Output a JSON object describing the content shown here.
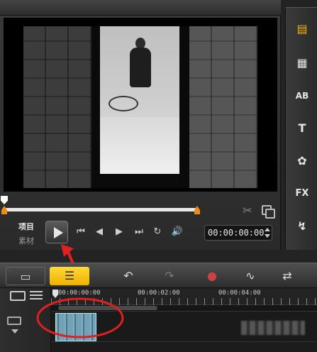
{
  "preview": {
    "mode_project": "项目",
    "mode_clip": "素材",
    "timecode": "00:00:00:00",
    "progress": 0
  },
  "transport": {
    "prev_icon": "⏮",
    "step_back_icon": "◀",
    "step_fwd_icon": "▶",
    "next_icon": "⏭",
    "repeat_icon": "↻",
    "volume_icon": "🔊"
  },
  "library_tools": [
    {
      "name": "media-icon",
      "label": "▤"
    },
    {
      "name": "instant-project-icon",
      "label": "▦"
    },
    {
      "name": "transition-icon",
      "label": "AB"
    },
    {
      "name": "title-icon",
      "label": "T"
    },
    {
      "name": "graphics-icon",
      "label": "✿"
    },
    {
      "name": "filter-icon",
      "label": "FX"
    },
    {
      "name": "path-icon",
      "label": "↯"
    }
  ],
  "timeline_toolbar": {
    "storyboard_icon": "▭",
    "timeline_icon": "☰",
    "undo_icon": "↶",
    "redo_icon": "↷",
    "record_icon": "●",
    "audio_icon": "∿",
    "mix_icon": "⇄"
  },
  "ruler": {
    "labels": [
      "00:00:00:00",
      "00:00:02:00",
      "00:00:04:00"
    ]
  },
  "colors": {
    "accent": "#f0b000",
    "scrub_handle": "#f08a1a",
    "annotation": "#e02020"
  }
}
